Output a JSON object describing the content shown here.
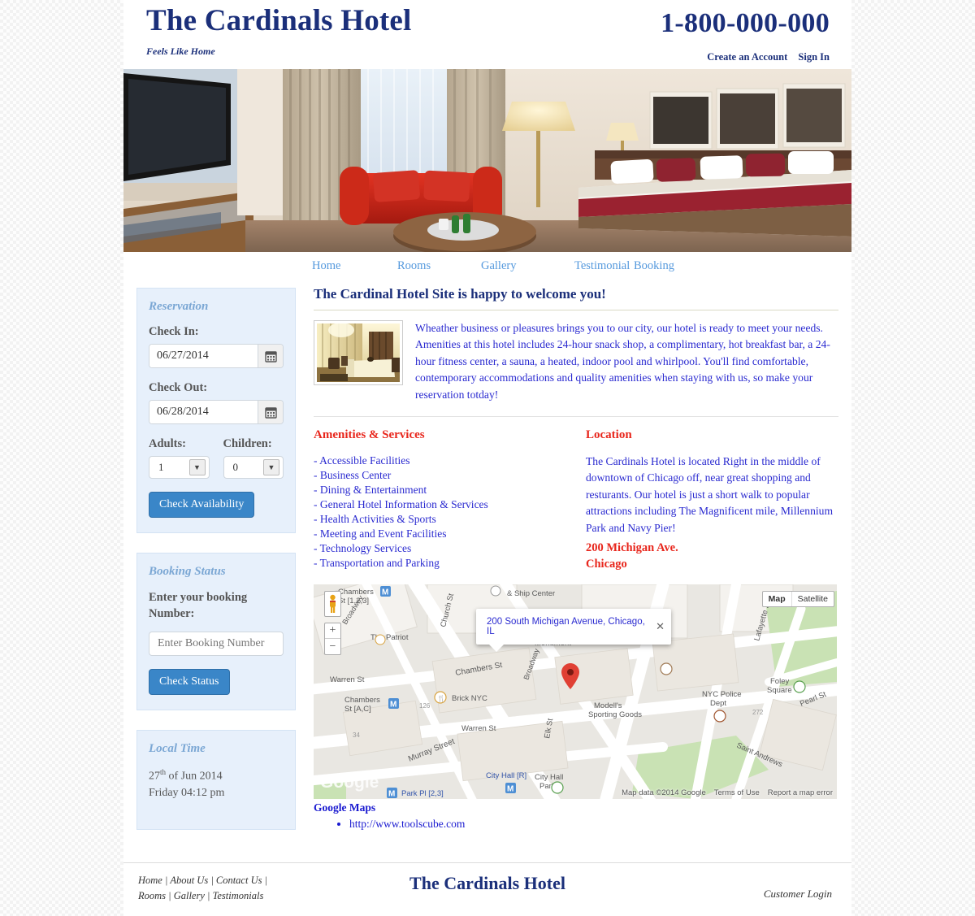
{
  "header": {
    "brand_title": "The Cardinals Hotel",
    "tagline": "Feels Like Home",
    "phone": "1-800-000-000",
    "create_account": "Create an Account",
    "sign_in": "Sign In"
  },
  "nav": {
    "home": "Home",
    "rooms": "Rooms",
    "gallery": "Gallery",
    "testimonial": "Testimonial",
    "booking": "Booking"
  },
  "sidebar": {
    "reservation": {
      "title": "Reservation",
      "checkin_label": "Check In:",
      "checkin_value": "06/27/2014",
      "checkout_label": "Check Out:",
      "checkout_value": "06/28/2014",
      "adults_label": "Adults:",
      "adults_value": "1",
      "children_label": "Children:",
      "children_value": "0",
      "submit": "Check Availability"
    },
    "booking_status": {
      "title": "Booking Status",
      "label": "Enter your booking Number:",
      "placeholder": "Enter Booking Number",
      "value": "",
      "submit": "Check Status"
    },
    "local_time": {
      "title": "Local Time",
      "day_number": "27",
      "day_suffix": "th",
      "date_rest": " of Jun 2014",
      "weekday_time": "Friday 04:12 pm"
    }
  },
  "main": {
    "welcome_title": "The Cardinal Hotel Site is happy to welcome you!",
    "intro_paragraph": "Wheather business or pleasures brings you to our city, our hotel is ready to meet your needs. Amenities at this hotel includes 24-hour snack shop, a complimentary, hot breakfast bar, a 24-hour fitness center, a sauna, a heated, indoor pool and whirlpool. You'll find comfortable, contemporary accommodations and quality amenities when staying with us, so make your reservation totday!",
    "amenities": {
      "heading": "Amenities & Services",
      "items": [
        "- Accessible Facilities",
        "- Business Center",
        "- Dining & Entertainment",
        "- General Hotel Information & Services",
        "- Health Activities & Sports",
        "- Meeting and Event Facilities",
        "- Technology Services",
        "- Transportation and Parking"
      ]
    },
    "location": {
      "heading": "Location",
      "paragraph": "The Cardinals Hotel is located Right in the middle of downtown of Chicago off, near great shopping and resturants. Our hotel is just a short walk to popular attractions including The Magnificent mile, Millennium Park and Navy Pier!",
      "address_line1": "200 Michigan Ave.",
      "address_line2": "Chicago"
    },
    "map": {
      "info_window_text": "200 South Michigan Avenue, Chicago, IL",
      "close_icon": "close-icon",
      "type_map": "Map",
      "type_satellite": "Satellite",
      "zoom_in": "+",
      "zoom_out": "−",
      "attribution_data": "Map data ©2014 Google",
      "attribution_terms": "Terms of Use",
      "attribution_report": "Report a map error",
      "logo_text": "Google",
      "labels": [
        "Chambers St [1,2,3]",
        "& Ship Center",
        "The Patriot",
        "Broadway",
        "Church St",
        "Warren St",
        "Chambers St",
        "Chambers St [A,C]",
        "Brick NYC",
        "Murray Street",
        "City Hall [R]",
        "City Hall Park",
        "Park Pl [2,3]",
        "Ground National Monument",
        "Modell's Sporting Goods",
        "NYC Police Dept",
        "Foley Square",
        "Lafayette St",
        "Pearl St",
        "Elk St",
        "Saint Andrews"
      ]
    },
    "google_maps_link": "Google Maps",
    "site_url": "http://www.toolscube.com"
  },
  "footer": {
    "links_row1": "Home | About Us | Contact Us |",
    "links_row2": "Rooms | Gallery | Testimonials",
    "brand": "The Cardinals Hotel",
    "customer_login": "Customer Login"
  },
  "colors": {
    "brand_navy": "#1b2f7a",
    "accent_blue": "#3a86c8",
    "link_blue": "#5599dd",
    "body_blue": "#2a2ad0",
    "heading_red": "#e8261c",
    "panel_bg": "#e7f0fb"
  }
}
